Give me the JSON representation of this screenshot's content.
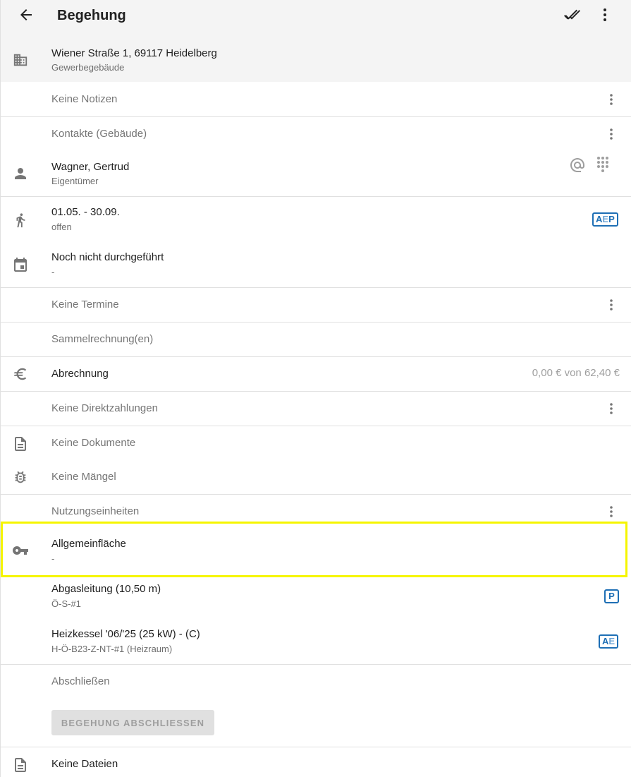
{
  "header": {
    "title": "Begehung"
  },
  "building": {
    "address": "Wiener Straße 1, 69117 Heidelberg",
    "type": "Gewerbegebäude"
  },
  "notes": {
    "label": "Keine Notizen"
  },
  "contacts": {
    "label": "Kontakte (Gebäude)",
    "person": {
      "name": "Wagner, Gertrud",
      "role": "Eigentümer"
    }
  },
  "inspection_period": {
    "dates": "01.05. - 30.09.",
    "status": "offen",
    "badge": {
      "strong": "A",
      "dim": "E",
      "strong2": "P"
    }
  },
  "execution": {
    "status": "Noch nicht durchgeführt",
    "detail": "-"
  },
  "appointments": {
    "label": "Keine Termine"
  },
  "collective_invoices": {
    "label": "Sammelrechnung(en)"
  },
  "billing": {
    "label": "Abrechnung",
    "amount": "0,00 € von 62,40 €"
  },
  "direct_payments": {
    "label": "Keine Direktzahlungen"
  },
  "documents": {
    "label": "Keine Dokumente"
  },
  "defects": {
    "label": "Keine Mängel"
  },
  "usage_units": {
    "label": "Nutzungseinheiten",
    "items": [
      {
        "name": "Allgemeinfläche",
        "detail": "-"
      },
      {
        "name": "Abgasleitung (10,50 m)",
        "detail": "Ö-S-#1",
        "badge": "P"
      },
      {
        "name": "Heizkessel '06/'25 (25 kW) - (C)",
        "detail": "H-Ö-B23-Z-NT-#1 (Heizraum)",
        "badge_strong": "A",
        "badge_dim": "E"
      }
    ]
  },
  "finish": {
    "label": "Abschließen",
    "button_label": "BEGEHUNG ABSCHLIESSEN"
  },
  "files": {
    "label": "Keine Dateien"
  },
  "colors": {
    "accent_blue": "#1e6fb5",
    "highlight": "#f5f500",
    "appbar_bg": "#f4f4f4"
  },
  "icons": [
    "back-arrow-icon",
    "done-all-icon",
    "more-vert-icon",
    "building-icon",
    "person-icon",
    "at-sign-icon",
    "dialpad-icon",
    "walking-icon",
    "calendar-icon",
    "euro-icon",
    "document-icon",
    "bug-icon",
    "key-icon"
  ]
}
